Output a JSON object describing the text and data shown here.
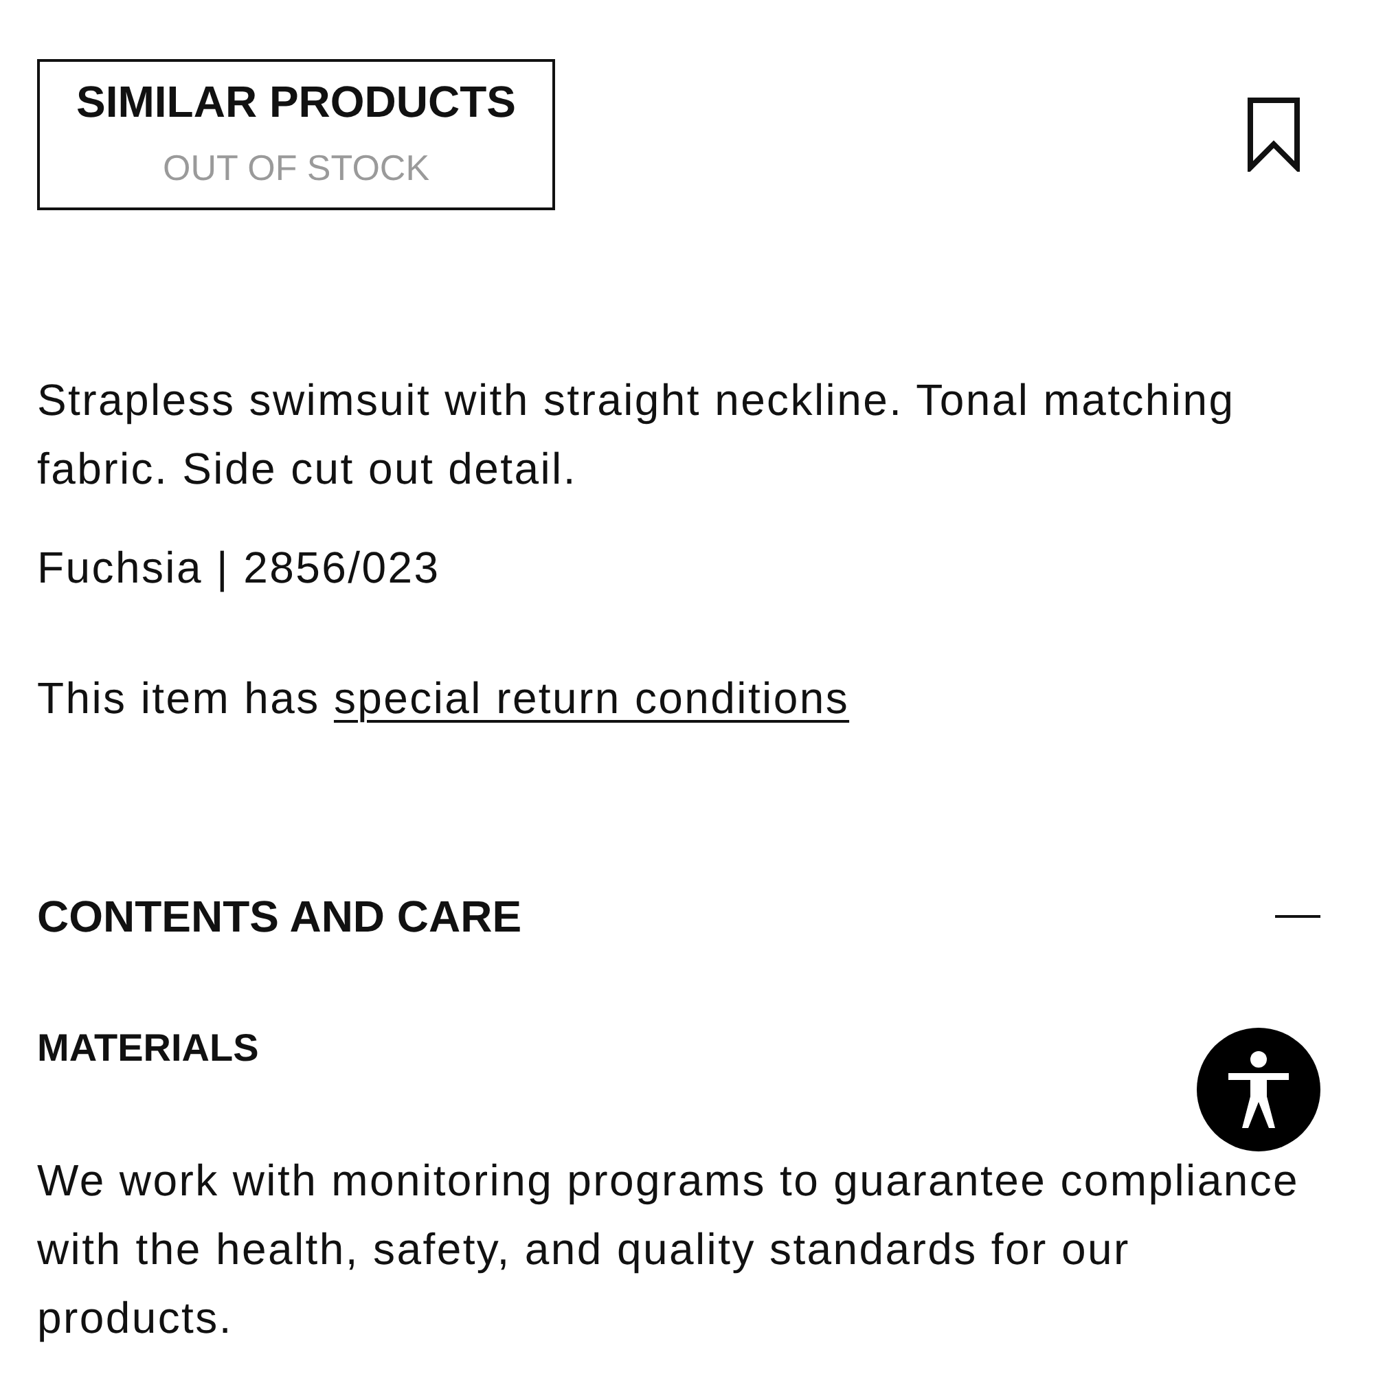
{
  "similar_products": {
    "label": "SIMILAR PRODUCTS",
    "status": "OUT OF STOCK"
  },
  "bookmark": {
    "saved": false
  },
  "product": {
    "description": "Strapless swimsuit with straight neckline. Tonal matching fabric. Side cut out detail.",
    "color_and_reference": "Fuchsia | 2856/023",
    "return_notice": {
      "text": "This item has",
      "link": "special return conditions"
    }
  },
  "sections": [
    {
      "title": "CONTENTS AND CARE",
      "expanded": true,
      "subsections": [
        {
          "title": "MATERIALS",
          "text": "We work with monitoring programs to guarantee compliance with the health, safety, and quality standards for our products."
        }
      ]
    }
  ]
}
